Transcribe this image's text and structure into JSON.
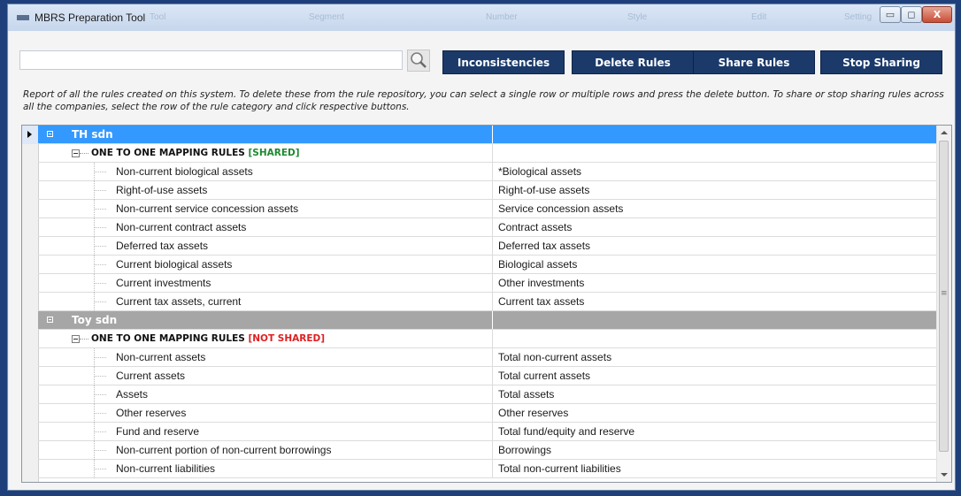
{
  "window": {
    "title": "MBRS Preparation Tool",
    "ghost_tabs": [
      "Tool",
      "Segment",
      "Number",
      "Style",
      "Edit",
      "Setting"
    ]
  },
  "controls": {
    "minimize_glyph": "▭",
    "maximize_glyph": "◻",
    "close_glyph": "X"
  },
  "search": {
    "value": "",
    "placeholder": "",
    "icon": "magnifier-icon"
  },
  "toolbar": {
    "inconsistencies_label": "Inconsistencies",
    "delete_label": "Delete Rules",
    "share_label": "Share Rules",
    "stop_label": "Stop Sharing"
  },
  "description": "Report of all the rules created on this system. To delete these from the rule repository, you can select a single row or multiple rows and press the delete button. To share or stop sharing rules across all the companies, select the row of the rule category and click respective buttons.",
  "grid": {
    "groups": [
      {
        "company": "TH sdn",
        "category_label": "ONE TO ONE MAPPING RULES",
        "category_tag": "[SHARED]",
        "rules": [
          [
            "Non-current biological assets",
            "*Biological assets"
          ],
          [
            "Right-of-use assets",
            "Right-of-use assets"
          ],
          [
            "Non-current service concession assets",
            "Service concession assets"
          ],
          [
            "Non-current contract assets",
            "Contract assets"
          ],
          [
            "Deferred tax assets",
            "Deferred tax assets"
          ],
          [
            "Current biological assets",
            "Biological assets"
          ],
          [
            "Current investments",
            "Other investments"
          ],
          [
            "Current tax assets, current",
            "Current tax assets"
          ]
        ]
      },
      {
        "company": "Toy sdn",
        "category_label": "ONE TO ONE MAPPING RULES",
        "category_tag": "[NOT SHARED]",
        "rules": [
          [
            "Non-current assets",
            "Total non-current assets"
          ],
          [
            "Current assets",
            "Total current assets"
          ],
          [
            "Assets",
            "Total assets"
          ],
          [
            "Other reserves",
            "Other reserves"
          ],
          [
            "Fund and reserve",
            "Total fund/equity and reserve"
          ],
          [
            "Non-current portion of non-current borrowings",
            "Borrowings"
          ],
          [
            "Non-current liabilities",
            "Total non-current liabilities"
          ]
        ]
      }
    ]
  },
  "colors": {
    "button_bg": "#1b3a6a",
    "selected_row": "#3399ff",
    "group_row": "#a6a6a6",
    "shared_tag": "#1d8a2e",
    "not_shared_tag": "#e02020"
  }
}
